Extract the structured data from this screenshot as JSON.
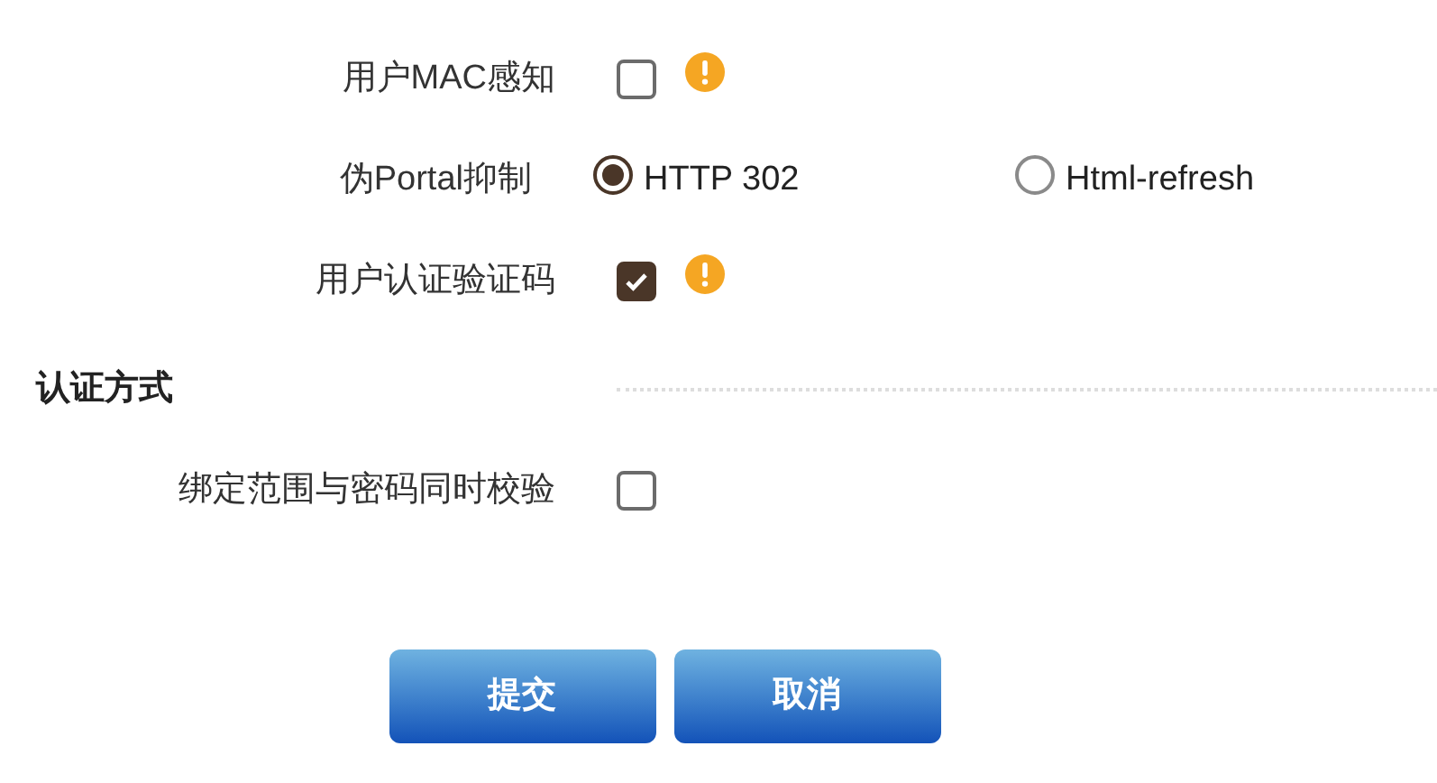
{
  "rows": [
    {
      "label": "用户MAC感知",
      "kind": "checkbox",
      "checked": false,
      "warning": true
    },
    {
      "label": "伪Portal抑制",
      "kind": "radio",
      "options": [
        {
          "label": "HTTP 302",
          "selected": true
        },
        {
          "label": "Html-refresh",
          "selected": false
        }
      ]
    },
    {
      "label": "用户认证验证码",
      "kind": "checkbox",
      "checked": true,
      "warning": true
    }
  ],
  "section": {
    "title": "认证方式",
    "rows": [
      {
        "label": "绑定范围与密码同时校验",
        "kind": "checkbox",
        "checked": false,
        "warning": false
      }
    ]
  },
  "buttons": [
    "提交",
    "取消"
  ]
}
